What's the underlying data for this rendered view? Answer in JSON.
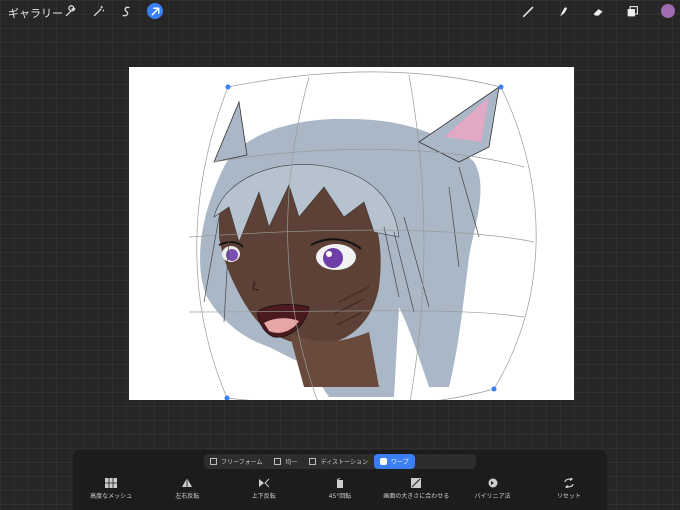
{
  "topbar": {
    "gallery_label": "ギャラリー",
    "left_tools": [
      "wrench-icon",
      "magic-wand-icon",
      "selection-icon",
      "transform-arrow-icon"
    ],
    "right_tools": [
      "brush-icon",
      "smudge-icon",
      "eraser-icon",
      "layers-icon"
    ],
    "color_swatch": "#a06bb0",
    "accent": "#3a7ff6"
  },
  "modes": [
    {
      "label": "フリーフォーム",
      "active": false
    },
    {
      "label": "均一",
      "active": false
    },
    {
      "label": "ディストーション",
      "active": false
    },
    {
      "label": "ワープ",
      "active": true
    }
  ],
  "actions": [
    {
      "label": "高度なメッシュ",
      "icon": "mesh-icon"
    },
    {
      "label": "左右反転",
      "icon": "flip-horizontal-icon"
    },
    {
      "label": "上下反転",
      "icon": "flip-vertical-icon"
    },
    {
      "label": "45°回転",
      "icon": "rotate-icon"
    },
    {
      "label": "画面の大きさに合わせる",
      "icon": "fit-screen-icon"
    },
    {
      "label": "バイリニア法",
      "icon": "bilinear-icon"
    },
    {
      "label": "リセット",
      "icon": "reset-icon"
    }
  ]
}
